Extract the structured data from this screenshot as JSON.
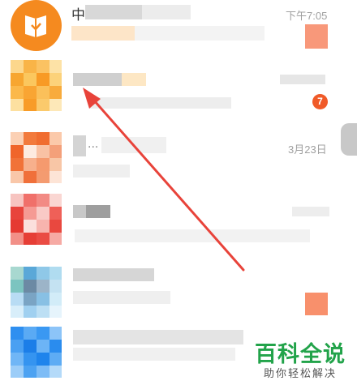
{
  "conversations": [
    {
      "title": "中",
      "time": "下午7:05",
      "badge": "",
      "avatar_icon": "book-icon",
      "avatar_color": "#f58a1f"
    },
    {
      "title": "",
      "time": "",
      "badge": "7",
      "avatar_icon": "pixelated-avatar",
      "avatar_color": "#f7a630"
    },
    {
      "title": "",
      "time": "3月23日",
      "badge": "",
      "avatar_icon": "pixelated-avatar",
      "avatar_color": "#f07a3c"
    },
    {
      "title": "",
      "time": "",
      "badge": "",
      "avatar_icon": "pixelated-avatar",
      "avatar_color": "#e8443c"
    },
    {
      "title": "",
      "time": "",
      "badge": "",
      "avatar_icon": "pixelated-avatar",
      "avatar_color": "#5aa8d8"
    },
    {
      "title": "",
      "time": "",
      "badge": "",
      "avatar_icon": "pixelated-avatar",
      "avatar_color": "#2f8ff0"
    }
  ],
  "annotation": {
    "icon": "red-arrow-icon",
    "color": "#e8433a"
  },
  "watermark": {
    "title": "百科全说",
    "subtitle": "助你轻松解决",
    "color": "#22a34a"
  }
}
